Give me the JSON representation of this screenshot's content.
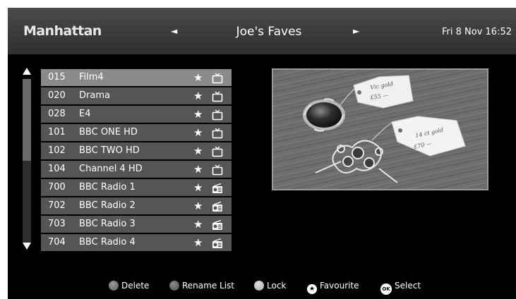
{
  "header": {
    "brand": "Manhattan",
    "list_title": "Joe's Faves",
    "prev_arrow": "◄",
    "next_arrow": "►",
    "clock": "Fri 8 Nov 16:52"
  },
  "channels": [
    {
      "number": "015",
      "name": "Film4",
      "favourite": "★",
      "type": "tv-icon"
    },
    {
      "number": "020",
      "name": "Drama",
      "favourite": "★",
      "type": "tv-icon"
    },
    {
      "number": "028",
      "name": "E4",
      "favourite": "★",
      "type": "tv-icon"
    },
    {
      "number": "101",
      "name": "BBC ONE HD",
      "favourite": "★",
      "type": "tv-icon"
    },
    {
      "number": "102",
      "name": "BBC TWO HD",
      "favourite": "★",
      "type": "tv-icon"
    },
    {
      "number": "104",
      "name": "Channel 4 HD",
      "favourite": "★",
      "type": "tv-icon"
    },
    {
      "number": "700",
      "name": "BBC Radio 1",
      "favourite": "★",
      "type": "radio-icon"
    },
    {
      "number": "702",
      "name": "BBC Radio 2",
      "favourite": "★",
      "type": "radio-icon"
    },
    {
      "number": "703",
      "name": "BBC Radio 3",
      "favourite": "★",
      "type": "radio-icon"
    },
    {
      "number": "704",
      "name": "BBC Radio 4",
      "favourite": "★",
      "type": "radio-icon"
    }
  ],
  "selected_index": 0,
  "preview": {
    "tag1_text": "Vic gold £55 —",
    "tag2_text": "14 ct gold £70 —"
  },
  "footer": {
    "delete": "Delete",
    "rename": "Rename List",
    "lock": "Lock",
    "favourite": "Favourite",
    "ok_badge": "OK",
    "select": "Select"
  },
  "colors": {
    "background": "#000000",
    "header": "#3f3f3f",
    "row": "#555555",
    "row_selected": "#8a8a8a"
  }
}
